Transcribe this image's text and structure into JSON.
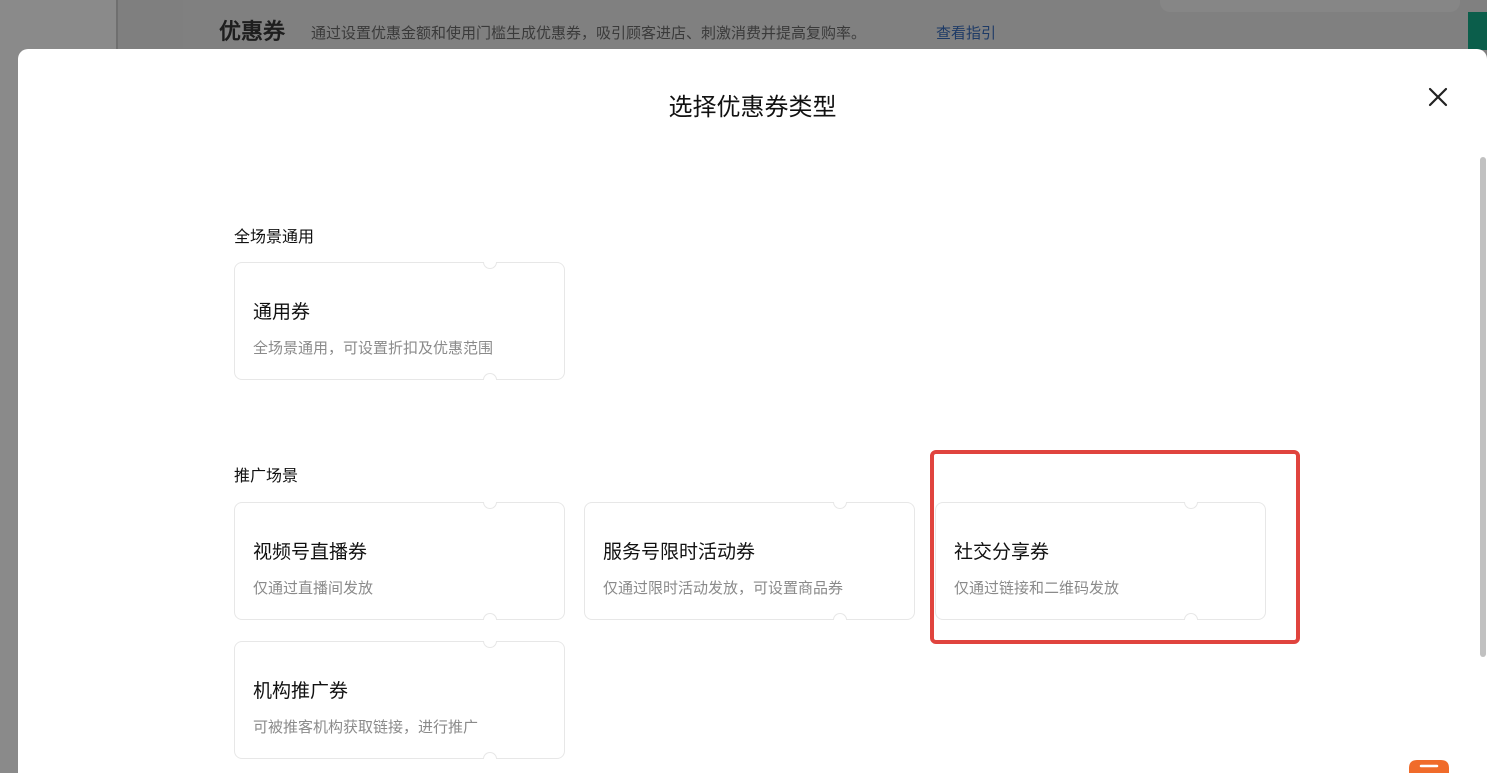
{
  "background": {
    "page_title": "优惠券",
    "page_desc": "通过设置优惠金额和使用门槛生成优惠券，吸引顾客进店、刺激消费并提高复购率。",
    "guide_link": "查看指引"
  },
  "modal": {
    "title": "选择优惠券类型",
    "close_icon": "close-icon",
    "sections": [
      {
        "title": "全场景通用",
        "cards": [
          {
            "title": "通用券",
            "desc": "全场景通用，可设置折扣及优惠范围"
          }
        ]
      },
      {
        "title": "推广场景",
        "cards": [
          {
            "title": "视频号直播券",
            "desc": "仅通过直播间发放"
          },
          {
            "title": "服务号限时活动券",
            "desc": "仅通过限时活动发放，可设置商品券"
          },
          {
            "title": "社交分享券",
            "desc": "仅通过链接和二维码发放"
          },
          {
            "title": "机构推广券",
            "desc": "可被推客机构获取链接，进行推广"
          }
        ]
      }
    ]
  },
  "colors": {
    "highlight": "#e0443e",
    "overlay": "#7f7f7f",
    "card_border": "#e7e7e7"
  }
}
